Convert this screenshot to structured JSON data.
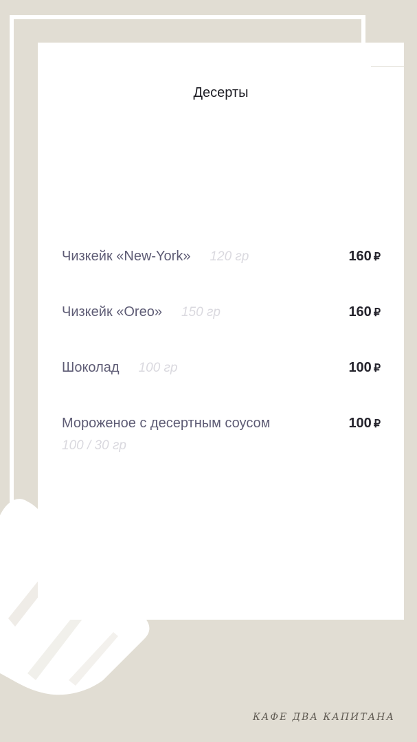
{
  "menu": {
    "title": "Десерты",
    "currency": "₽",
    "items": [
      {
        "name": "Чизкейк «New-York»",
        "weight": "120 гр",
        "price": "160"
      },
      {
        "name": "Чизкейк «Oreo»",
        "weight": "150 гр",
        "price": "160"
      },
      {
        "name": "Шоколад",
        "weight": "100 гр",
        "price": "100"
      },
      {
        "name": "Мороженое с десертным соусом",
        "weight": "100 / 30 гр",
        "price": "100"
      }
    ]
  },
  "footer": {
    "cafe_name": "КАФЕ ДВА КАПИТАНА"
  },
  "colors": {
    "background": "#e1ddd3",
    "card": "#ffffff",
    "item_text": "#5e5c75",
    "weight_text": "#dad9df"
  }
}
